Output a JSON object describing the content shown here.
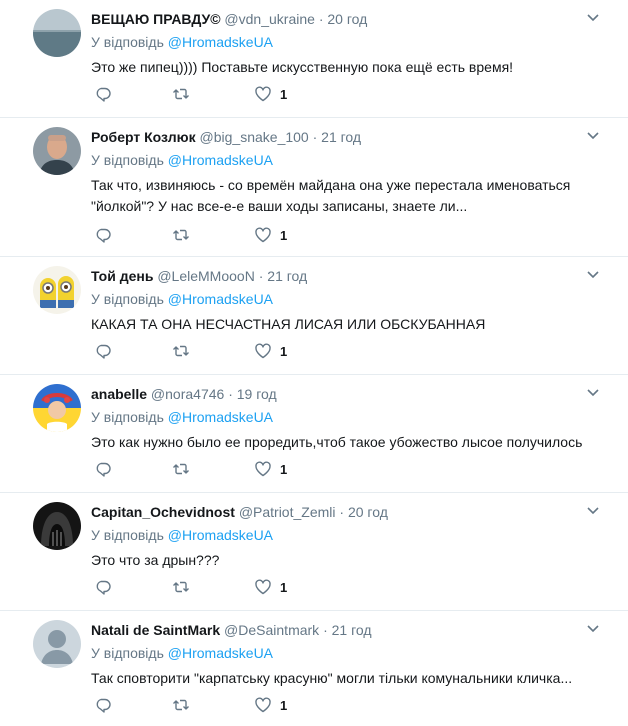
{
  "reply_prefix": "У відповідь",
  "tweets": [
    {
      "name": "ВЕЩАЮ ПРАВДУ©",
      "handle": "@vdn_ukraine",
      "dot": "·",
      "time": "20 год",
      "reply_to": "@HromadskeUA",
      "text": "Это же пипец)))) Поставьте искусственную пока ещё есть время!",
      "likes": "1",
      "avatar": "sea"
    },
    {
      "name": "Роберт Козлюк",
      "handle": "@big_snake_100",
      "dot": "·",
      "time": "21 год",
      "reply_to": "@HromadskeUA",
      "text": "Так что, извиняюсь - со времён майдана она уже перестала именоваться \"йолкой\"? У нас все-е-е ваши ходы записаны, знаете ли...",
      "likes": "1",
      "avatar": "man"
    },
    {
      "name": "Той день",
      "handle": "@LeleMMoooN",
      "dot": "·",
      "time": "21 год",
      "reply_to": "@HromadskeUA",
      "text": "КАКАЯ ТА ОНА НЕСЧАСТНАЯ ЛИСАЯ ИЛИ ОБСКУБАННАЯ",
      "likes": "1",
      "avatar": "minions"
    },
    {
      "name": "anabelle",
      "handle": "@nora4746",
      "dot": "·",
      "time": "19 год",
      "reply_to": "@HromadskeUA",
      "text": "Это как нужно было ее проредить,чтоб такое убожество лысое получилось",
      "likes": "1",
      "avatar": "flag"
    },
    {
      "name": "Capitan_Ochevidnost",
      "handle": "@Patriot_Zemli",
      "dot": "·",
      "time": "20 год",
      "reply_to": "@HromadskeUA",
      "text": "Это что за дрын???",
      "likes": "1",
      "avatar": "hood"
    },
    {
      "name": "Natali de SaintMark",
      "handle": "@DeSaintmark",
      "dot": "·",
      "time": "21 год",
      "reply_to": "@HromadskeUA",
      "text": "Так сповторити \"карпатську красуню\" могли тільки комунальники кличка...",
      "likes": "1",
      "avatar": "default"
    }
  ],
  "colors": {
    "link": "#1da1f2",
    "muted": "#657786",
    "text": "#14171a",
    "border": "#e6ecf0"
  }
}
